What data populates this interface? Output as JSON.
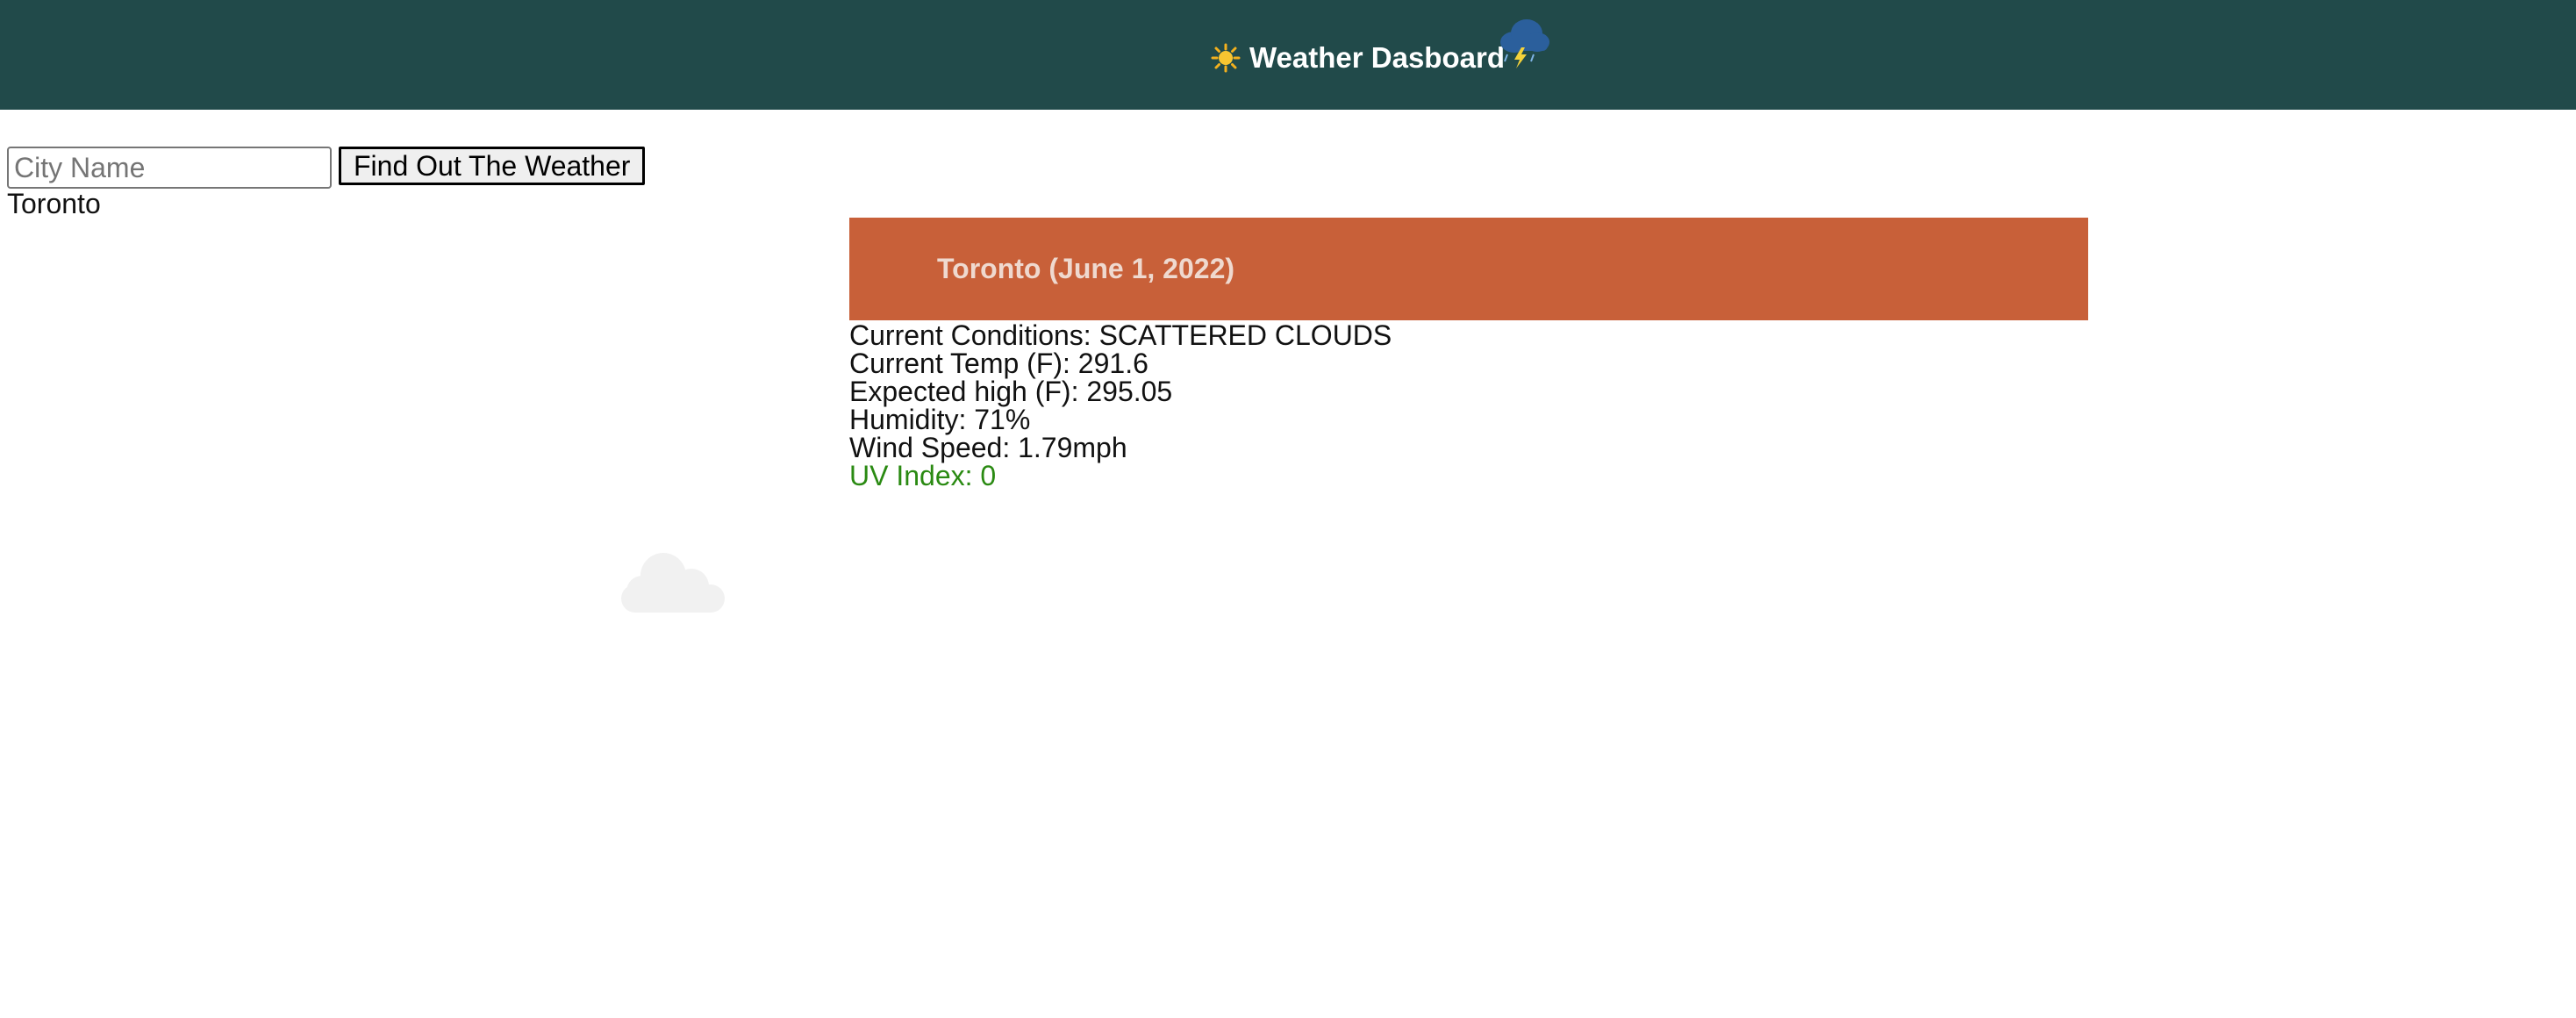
{
  "header": {
    "title": "Weather Dasboard",
    "title_icon": "sun-icon",
    "side_icon": "thunderstorm-cloud-icon"
  },
  "search": {
    "placeholder": "City Name",
    "value": "",
    "button_label": "Find Out The Weather"
  },
  "history": {
    "items": [
      "Toronto"
    ]
  },
  "current": {
    "title": "Toronto (June 1, 2022)",
    "icon": "cloud-icon",
    "conditions": "Current Conditions: SCATTERED CLOUDS",
    "temp": "Current Temp (F): 291.6",
    "high": "Expected high (F): 295.05",
    "humidity": "Humidity: 71%",
    "wind": "Wind Speed: 1.79mph",
    "uv": "UV Index: 0"
  },
  "colors": {
    "header_bg": "#214a4a",
    "card_header_bg": "#c86039",
    "uv_ok": "#2a8a12"
  }
}
